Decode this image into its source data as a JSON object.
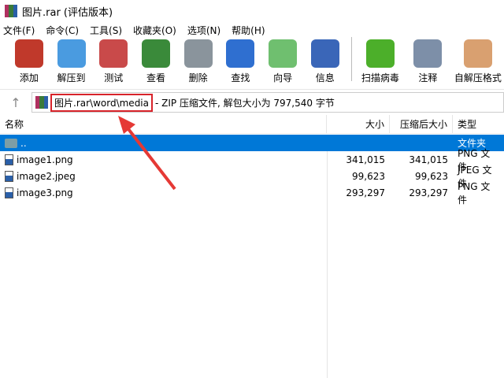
{
  "window": {
    "title": "图片.rar (评估版本)"
  },
  "menu": [
    "文件(F)",
    "命令(C)",
    "工具(S)",
    "收藏夹(O)",
    "选项(N)",
    "帮助(H)"
  ],
  "toolbar": [
    {
      "label": "添加",
      "icon": "add-archive-icon",
      "color": "#c0392b"
    },
    {
      "label": "解压到",
      "icon": "extract-folder-icon",
      "color": "#4a9be0"
    },
    {
      "label": "测试",
      "icon": "test-clipboard-icon",
      "color": "#c94a4a"
    },
    {
      "label": "查看",
      "icon": "view-book-icon",
      "color": "#3a8a3a"
    },
    {
      "label": "删除",
      "icon": "trash-icon",
      "color": "#8a949c"
    },
    {
      "label": "查找",
      "icon": "search-magnifier-icon",
      "color": "#2f6fd0"
    },
    {
      "label": "向导",
      "icon": "wizard-wand-icon",
      "color": "#6fbf6f"
    },
    {
      "label": "信息",
      "icon": "info-icon",
      "color": "#3a66b8"
    },
    {
      "label": "扫描病毒",
      "icon": "virus-scan-icon",
      "color": "#4caf2a"
    },
    {
      "label": "注释",
      "icon": "comment-icon",
      "color": "#7d8fa8"
    },
    {
      "label": "自解压格式",
      "icon": "sfx-box-icon",
      "color": "#d9a070"
    }
  ],
  "address": {
    "path": "图片.rar\\word\\media",
    "description": "- ZIP 压缩文件, 解包大小为 797,540 字节"
  },
  "columns": {
    "name": "名称",
    "size": "大小",
    "packed": "压缩后大小",
    "type": "类型"
  },
  "files": [
    {
      "name": "..",
      "size": "",
      "packed": "",
      "type": "文件夹",
      "selected": true
    },
    {
      "name": "image1.png",
      "size": "341,015",
      "packed": "341,015",
      "type": "PNG 文件"
    },
    {
      "name": "image2.jpeg",
      "size": "99,623",
      "packed": "99,623",
      "type": "JPEG 文件"
    },
    {
      "name": "image3.png",
      "size": "293,297",
      "packed": "293,297",
      "type": "PNG 文件"
    }
  ],
  "colors": {
    "selection": "#0078d7",
    "annotation": "#d8232a"
  }
}
